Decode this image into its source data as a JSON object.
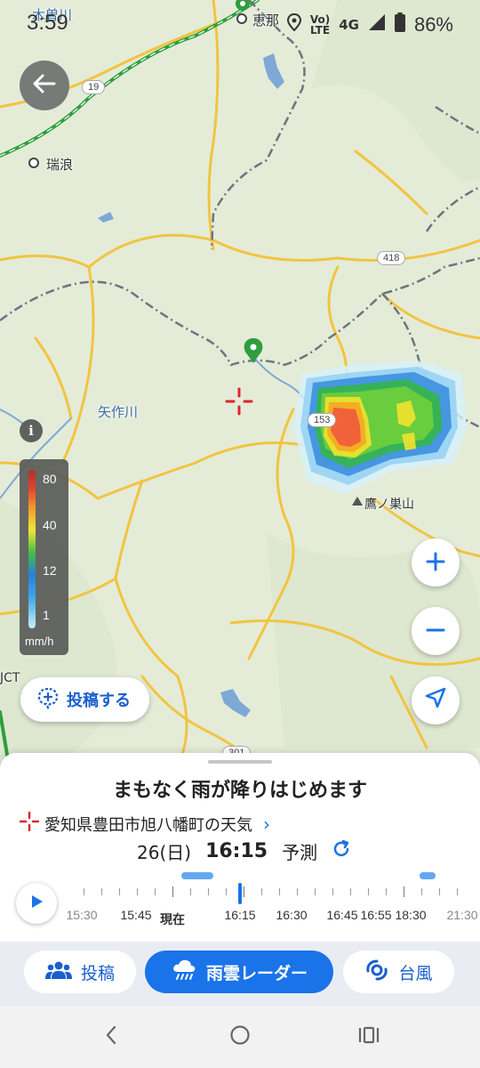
{
  "status_bar": {
    "time": "3:59",
    "network_top": "Vo)",
    "network_bottom": "LTE",
    "network_type": "4G",
    "battery": "86%"
  },
  "map": {
    "labels": {
      "river_kiso": "木曽川",
      "city_ena": "恵那",
      "city_mizunami": "瑞浪",
      "river_yahagi": "矢作川",
      "mountain": "鷹ノ巣山",
      "jct": "JCT"
    },
    "road_shields": {
      "r19": "19",
      "r418": "418",
      "r153": "153",
      "r301": "301"
    }
  },
  "legend": {
    "info_label": "i",
    "ticks": [
      "80",
      "40",
      "12",
      "1"
    ],
    "unit": "mm/h"
  },
  "controls": {
    "post_button_label": "投稿する"
  },
  "sheet": {
    "headline": "まもなく雨が降りはじめます",
    "location": "愛知県豊田市旭八幡町の天気",
    "date": "26(日)",
    "time": "16:15",
    "mode": "予測",
    "timeline_labels": [
      "15:30",
      "15:45",
      "現在",
      "16:15",
      "16:30",
      "16:45",
      "16:55",
      "18:30",
      "21:30"
    ]
  },
  "tabs": [
    {
      "label": "投稿",
      "icon": "people-icon"
    },
    {
      "label": "雨雲レーダー",
      "icon": "rain-cloud-icon"
    },
    {
      "label": "台風",
      "icon": "typhoon-icon"
    }
  ],
  "colors": {
    "accent": "#1a73e8",
    "map_bg": "#e4ecd8",
    "road_yellow": "#f2c440",
    "pin_green": "#2e9e3e"
  }
}
